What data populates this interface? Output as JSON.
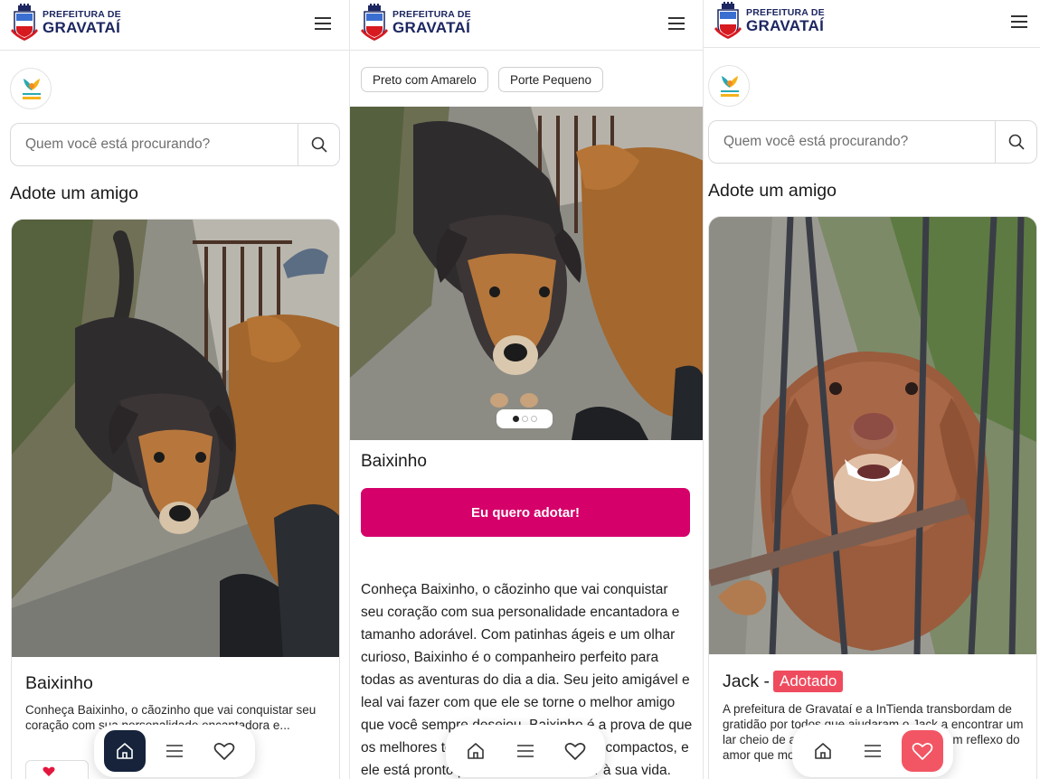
{
  "header": {
    "logo_line1": "PREFEITURA DE",
    "logo_line2": "GRAVATAÍ"
  },
  "colors": {
    "brand_navy": "#1c2660",
    "adopt_button": "#d5006a",
    "adopted_badge": "#ef4b5e",
    "nav_active_dark": "#16233b",
    "nav_active_red": "#f25664"
  },
  "search": {
    "placeholder": "Quem você está procurando?"
  },
  "listing": {
    "section_title": "Adote um amigo",
    "pets": [
      {
        "name": "Baixinho",
        "description": "Conheça Baixinho, o cãozinho que vai conquistar seu coração com sua personalidade encantadora e..."
      },
      {
        "name": "Jack -",
        "status": "Adotado",
        "description": "A prefeitura de Gravataí e a InTienda transbordam de gratidão por todos que ajudaram o Jack a encontrar um lar cheio de amor e carinho. Seu gesto é um reflexo do amor que move corações."
      }
    ]
  },
  "detail": {
    "tags": [
      "Preto com Amarelo",
      "Porte Pequeno"
    ],
    "name": "Baixinho",
    "adopt_button": "Eu quero adotar!",
    "description": "Conheça Baixinho, o cãozinho que vai conquistar seu coração com sua personalidade encantadora e tamanho adorável. Com patinhas ágeis e um olhar curioso, Baixinho é o companheiro perfeito para todas as aventuras do dia a dia. Seu jeito amigável e leal vai fazer com que ele se torne o melhor amigo que você sempre desejou. Baixinho é a prova de que os melhores tesouros vêm em pacotes compactos, e ele está pronto para trazer muito amor à sua vida.",
    "carousel": {
      "current": 1,
      "total": 3
    }
  },
  "nav": {
    "items": [
      "home-icon",
      "menu-icon",
      "heart-icon"
    ]
  }
}
